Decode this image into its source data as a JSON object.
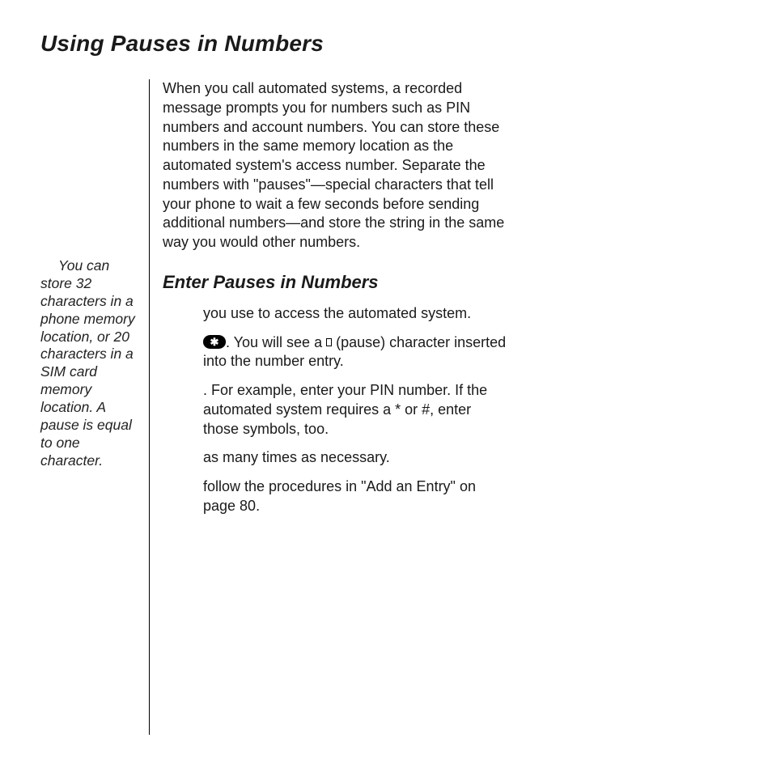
{
  "heading": "Using Pauses in Numbers",
  "intro": "When you call automated systems, a recorded message prompts you for numbers such as PIN numbers and account numbers. You can store these numbers in the same memory location as the automated system's access number. Separate the numbers with \"pauses\"—special characters that tell your phone to wait a few seconds before sending additional numbers—and store the string in the same way you would other numbers.",
  "sidebar_note": "You can store 32 characters in a phone memory location, or 20 characters in a SIM card memory location. A pause is equal to one character.",
  "sub_heading": "Enter Pauses in Numbers",
  "key_symbol": "✱",
  "steps": {
    "s1_tail": " you use to access the automated system.",
    "s2_after_key": ". You will see a ",
    "s2_tail": " (pause) character inserted into the number entry.",
    "s3_tail": ". For example, enter your PIN number. If the automated system requires a * or #, enter those symbols, too.",
    "s4_tail": " as many times as necessary.",
    "s5_tail": " follow the procedures in \"Add an Entry\" on page 80."
  }
}
